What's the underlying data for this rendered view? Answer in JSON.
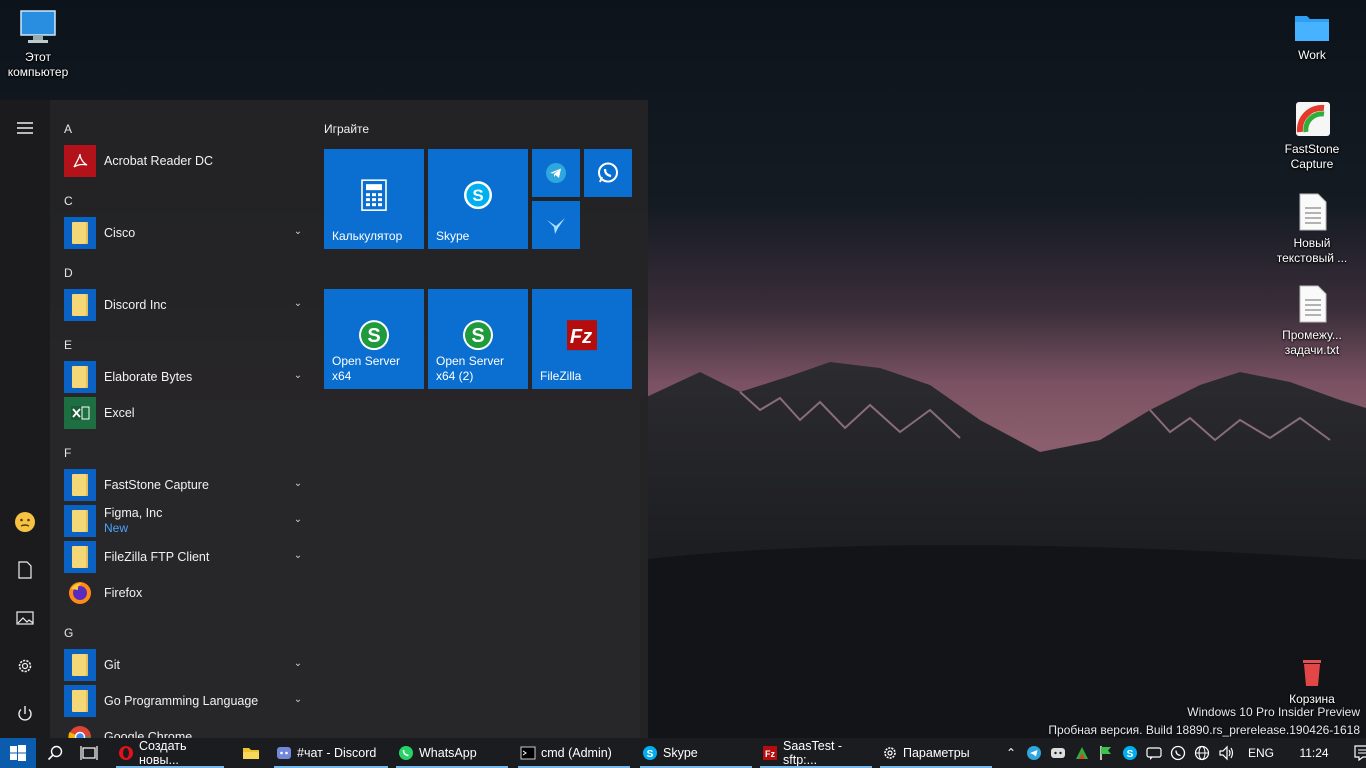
{
  "desktop": {
    "icons": {
      "this_pc": "Этот компьютер",
      "work": "Work",
      "faststone": "FastStone Capture",
      "new_text": "Новый текстовый ...",
      "interim": "Промежу... задачи.txt",
      "recycle": "Корзина"
    },
    "watermark": {
      "line1": "Windows 10 Pro Insider Preview",
      "line2": "Пробная версия. Build 18890.rs_prerelease.190426-1618"
    }
  },
  "start_menu": {
    "letters": {
      "a": "A",
      "c": "C",
      "d": "D",
      "e": "E",
      "f": "F",
      "g": "G"
    },
    "apps": {
      "acrobat": "Acrobat Reader DC",
      "cisco": "Cisco",
      "discord": "Discord Inc",
      "elaborate": "Elaborate Bytes",
      "excel": "Excel",
      "faststone": "FastStone Capture",
      "figma": "Figma, Inc",
      "figma_badge": "New",
      "filezilla": "FileZilla FTP Client",
      "firefox": "Firefox",
      "git": "Git",
      "go": "Go Programming Language",
      "chrome": "Google Chrome"
    },
    "tiles_header": "Играйте",
    "tiles": {
      "calculator": "Калькулятор",
      "skype": "Skype",
      "openserver": "Open Server x64",
      "openserver2": "Open Server x64 (2)",
      "filezilla": "FileZilla"
    }
  },
  "taskbar": {
    "apps": {
      "opera": "Создать новы...",
      "discord": "#чат - Discord",
      "whatsapp": "WhatsApp",
      "cmd": "cmd (Admin)",
      "skype": "Skype",
      "filezilla": "SaasTest - sftp:...",
      "settings": "Параметры"
    },
    "lang": "ENG",
    "clock": "11:24"
  },
  "colors": {
    "accent": "#0a6fd0",
    "taskbar": "#1b1c1f",
    "start_bg": "#242426"
  }
}
